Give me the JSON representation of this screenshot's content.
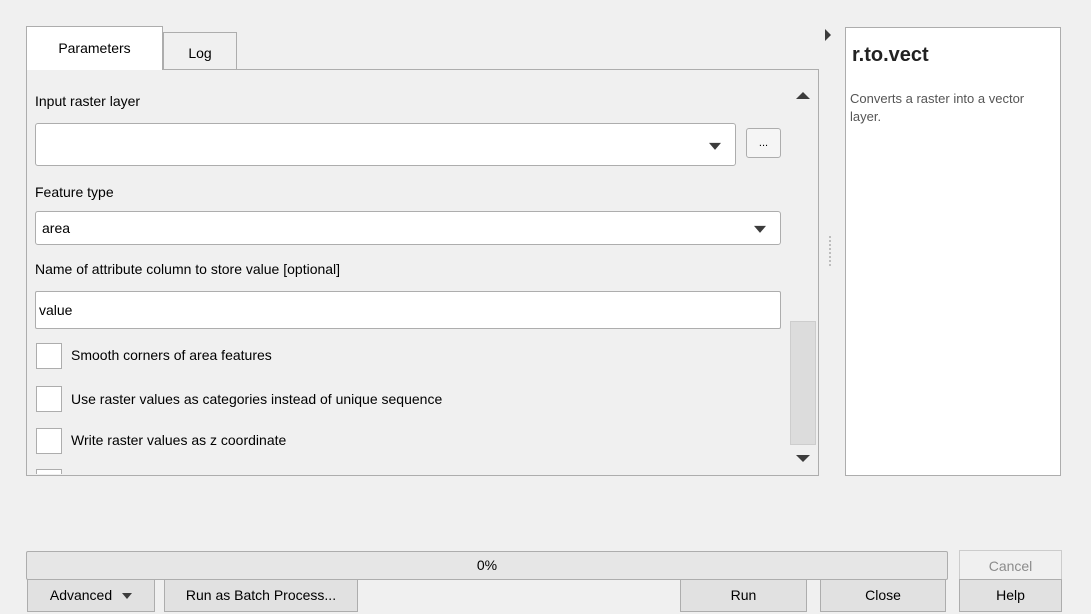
{
  "tabs": [
    {
      "label": "Parameters",
      "active": true
    },
    {
      "label": "Log",
      "active": false
    }
  ],
  "params": {
    "input_raster_label": "Input raster layer",
    "input_raster_value": "",
    "browse_label": "...",
    "feature_type_label": "Feature type",
    "feature_type_value": "area",
    "attr_column_label": "Name of attribute column to store value [optional]",
    "attr_column_value": "value",
    "checkboxes": [
      {
        "label": "Smooth corners of area features",
        "checked": false
      },
      {
        "label": "Use raster values as categories instead of unique sequence",
        "checked": false
      },
      {
        "label": "Write raster values as z coordinate",
        "checked": false
      }
    ]
  },
  "help": {
    "title": "r.to.vect",
    "description": "Converts a raster into a vector layer."
  },
  "progress": {
    "value": 0,
    "text": "0%"
  },
  "buttons": {
    "cancel": "Cancel",
    "advanced": "Advanced",
    "batch": "Run as Batch Process...",
    "run": "Run",
    "close": "Close",
    "help": "Help"
  },
  "colors": {
    "window_bg": "#f0f0f0",
    "field_bg": "#ffffff",
    "border": "#adadad"
  }
}
